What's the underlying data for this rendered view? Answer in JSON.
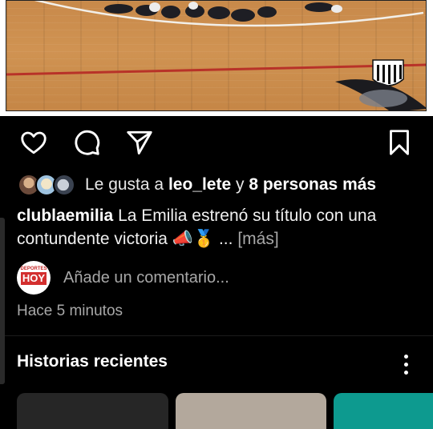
{
  "post": {
    "likes": {
      "prefix": "Le gusta a",
      "user": "leo_lete",
      "connector": "y",
      "others": "8 personas más"
    },
    "caption": {
      "username": "clublaemilia",
      "text": "La Emilia estrenó su título con una contundente victoria",
      "emoji": "📣🥇",
      "ellipsis": "...",
      "more": "[más]"
    },
    "comment": {
      "avatar_top": "DEPORTES",
      "avatar_main": "HOY",
      "placeholder": "Añade un comentario..."
    },
    "time": "Hace 5 minutos"
  },
  "actions": {
    "like_icon": "heart-icon",
    "comment_icon": "comment-icon",
    "share_icon": "send-icon",
    "save_icon": "bookmark-icon"
  },
  "stories": {
    "title": "Historias recientes",
    "menu_icon": "kebab-icon",
    "thumbs": [
      {
        "color": "#262626"
      },
      {
        "color": "#b3a89c"
      },
      {
        "color": "#0d9a8f"
      }
    ]
  },
  "colors": {
    "background": "#000000",
    "text": "#f5f5f5",
    "muted": "#a8a8a8",
    "floor": "#c98a4a",
    "court_line_red": "#c62828"
  }
}
